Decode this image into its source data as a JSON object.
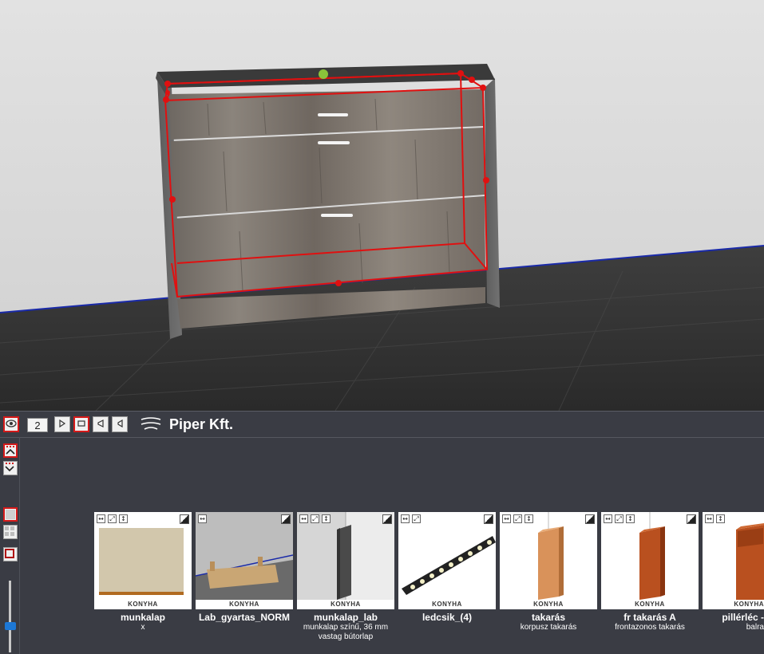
{
  "toolbar": {
    "view_count": "2",
    "company": "Piper Kft."
  },
  "catalog": {
    "items": [
      {
        "title": "munkalap",
        "subtitle": "x",
        "brand": "KONYHA"
      },
      {
        "title": "Lab_gyartas_NORM",
        "subtitle": "",
        "brand": "KONYHA"
      },
      {
        "title": "munkalap_lab",
        "subtitle": "munkalap színű, 36 mm vastag bútorlap",
        "brand": "KONYHA"
      },
      {
        "title": "ledcsik_(4)",
        "subtitle": "",
        "brand": "KONYHA"
      },
      {
        "title": "takarás",
        "subtitle": "korpusz takarás",
        "brand": "KONYHA"
      },
      {
        "title": "fr takarás A",
        "subtitle": "frontazonos takarás",
        "brand": "KONYHA"
      },
      {
        "title": "pillérléc -",
        "subtitle": "balra",
        "brand": "KONYHA"
      }
    ]
  },
  "colors": {
    "selection": "#e01010",
    "accent": "#1d78d6",
    "panel": "#3a3c44"
  }
}
